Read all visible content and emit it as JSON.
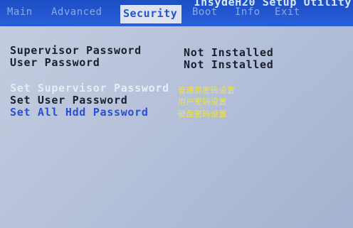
{
  "window": {
    "title": "InsydeH20 Setup Utility"
  },
  "tabs": [
    {
      "label": "Main"
    },
    {
      "label": "Advanced"
    },
    {
      "label": "Security"
    },
    {
      "label": "Boot"
    },
    {
      "label": "Info"
    },
    {
      "label": "Exit"
    }
  ],
  "status": {
    "supervisor_label": "Supervisor Password",
    "supervisor_value": "Not Installed",
    "user_label": "User Password",
    "user_value": "Not Installed"
  },
  "menu": {
    "set_supervisor": "Set Supervisor Password",
    "set_user": "Set User Password",
    "set_all_hdd": "Set All Hdd Password"
  },
  "annotations": {
    "set_supervisor": "管理员密码设置",
    "set_user": "用户密码设置",
    "set_all_hdd": "硬盘密码设置"
  },
  "colors": {
    "header_blue": "#2457d0",
    "panel_grey": "#b7c2da",
    "selected_blue": "#2a4fd6",
    "annotation_yellow": "#f2e23a"
  }
}
